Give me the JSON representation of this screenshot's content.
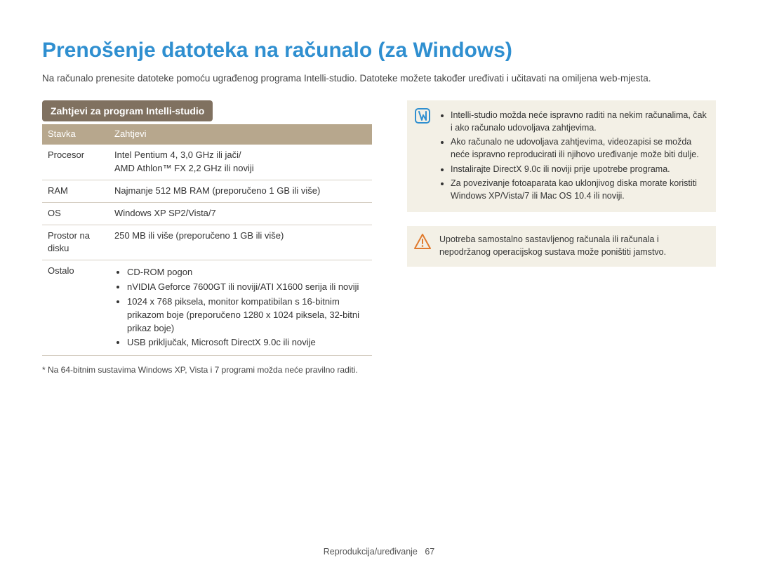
{
  "title": "Prenošenje datoteka na računalo (za Windows)",
  "intro": "Na računalo prenesite datoteke pomoću ugrađenog programa Intelli-studio. Datoteke možete također uređivati i učitavati na omiljena web-mjesta.",
  "section_heading": "Zahtjevi za program Intelli-studio",
  "table": {
    "headers": {
      "item": "Stavka",
      "req": "Zahtjevi"
    },
    "rows": {
      "cpu": {
        "label": "Procesor",
        "line1": "Intel Pentium 4, 3,0 GHz ili jači/",
        "line2": "AMD Athlon™ FX 2,2 GHz ili noviji"
      },
      "ram": {
        "label": "RAM",
        "value": "Najmanje 512 MB RAM (preporučeno 1 GB ili više)"
      },
      "os": {
        "label": "OS",
        "value": "Windows XP SP2/Vista/7"
      },
      "disk": {
        "label": "Prostor na disku",
        "value": "250 MB ili više (preporučeno 1 GB ili više)"
      },
      "other": {
        "label": "Ostalo",
        "items": {
          "0": "CD-ROM pogon",
          "1": "nVIDIA Geforce 7600GT ili noviji/ATI X1600 serija ili noviji",
          "2": "1024 x 768 piksela, monitor kompatibilan s 16-bitnim prikazom boje (preporučeno 1280 x 1024 piksela, 32-bitni prikaz boje)",
          "3": "USB priključak, Microsoft DirectX 9.0c ili novije"
        }
      }
    }
  },
  "footnote": "* Na 64-bitnim sustavima Windows XP, Vista i 7 programi možda neće pravilno raditi.",
  "info_box": {
    "items": {
      "0": "Intelli-studio možda neće ispravno raditi na nekim računalima, čak i ako računalo udovoljava zahtjevima.",
      "1": "Ako računalo ne udovoljava zahtjevima, videozapisi se možda neće ispravno reproducirati ili njihovo uređivanje može biti dulje.",
      "2": "Instalirajte DirectX 9.0c ili noviji prije upotrebe programa.",
      "3": "Za povezivanje fotoaparata kao uklonjivog diska morate koristiti Windows XP/Vista/7 ili Mac OS 10.4 ili noviji."
    }
  },
  "warn_box": {
    "text": "Upotreba samostalno sastavljenog računala ili računala i nepodržanog operacijskog sustava može poništiti jamstvo."
  },
  "footer": {
    "section": "Reprodukcija/uređivanje",
    "page": "67"
  }
}
